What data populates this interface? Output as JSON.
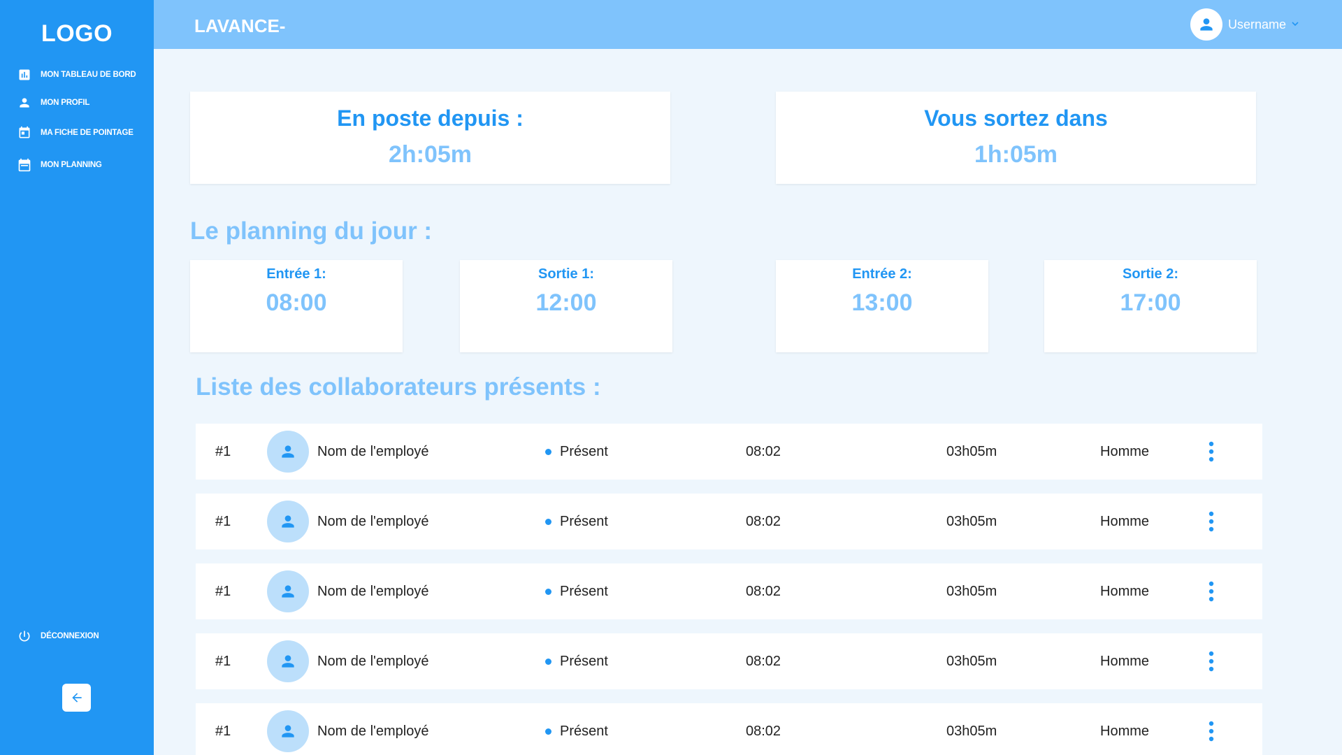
{
  "sidebar": {
    "logo": "LOGO",
    "items": [
      {
        "label": "MON TABLEAU DE BORD",
        "icon": "bar-chart-icon"
      },
      {
        "label": "MON PROFIL",
        "icon": "person-icon"
      },
      {
        "label": "MA FICHE DE POINTAGE",
        "icon": "calendar-day-icon"
      },
      {
        "label": "MON PLANNING",
        "icon": "calendar-icon"
      }
    ],
    "logout_label": "DÉCONNEXION",
    "logout_icon": "power-icon",
    "collapse_icon": "arrow-left-icon"
  },
  "header": {
    "brand": "LAVANCE-",
    "username": "Username"
  },
  "stats": [
    {
      "title": "En poste depuis :",
      "value": "2h:05m"
    },
    {
      "title": "Vous sortez dans",
      "value": "1h:05m"
    }
  ],
  "planning": {
    "title": "Le planning du jour  :",
    "items": [
      {
        "label": "Entrée 1:",
        "time": "08:00"
      },
      {
        "label": "Sortie 1:",
        "time": "12:00"
      },
      {
        "label": "Entrée 2:",
        "time": "13:00"
      },
      {
        "label": "Sortie 2:",
        "time": "17:00"
      }
    ]
  },
  "collaborators": {
    "title": "Liste des collaborateurs présents :",
    "rows": [
      {
        "rank": "#1",
        "name": "Nom de l'employé",
        "status": "Présent",
        "arrival": "08:02",
        "duration": "03h05m",
        "gender": "Homme"
      },
      {
        "rank": "#1",
        "name": "Nom de l'employé",
        "status": "Présent",
        "arrival": "08:02",
        "duration": "03h05m",
        "gender": "Homme"
      },
      {
        "rank": "#1",
        "name": "Nom de l'employé",
        "status": "Présent",
        "arrival": "08:02",
        "duration": "03h05m",
        "gender": "Homme"
      },
      {
        "rank": "#1",
        "name": "Nom de l'employé",
        "status": "Présent",
        "arrival": "08:02",
        "duration": "03h05m",
        "gender": "Homme"
      },
      {
        "rank": "#1",
        "name": "Nom de l'employé",
        "status": "Présent",
        "arrival": "08:02",
        "duration": "03h05m",
        "gender": "Homme"
      }
    ]
  },
  "colors": {
    "primary": "#2196f3",
    "light": "#7fc3fc",
    "background": "#eef6fd",
    "avatar_bg": "#bcdffb"
  }
}
